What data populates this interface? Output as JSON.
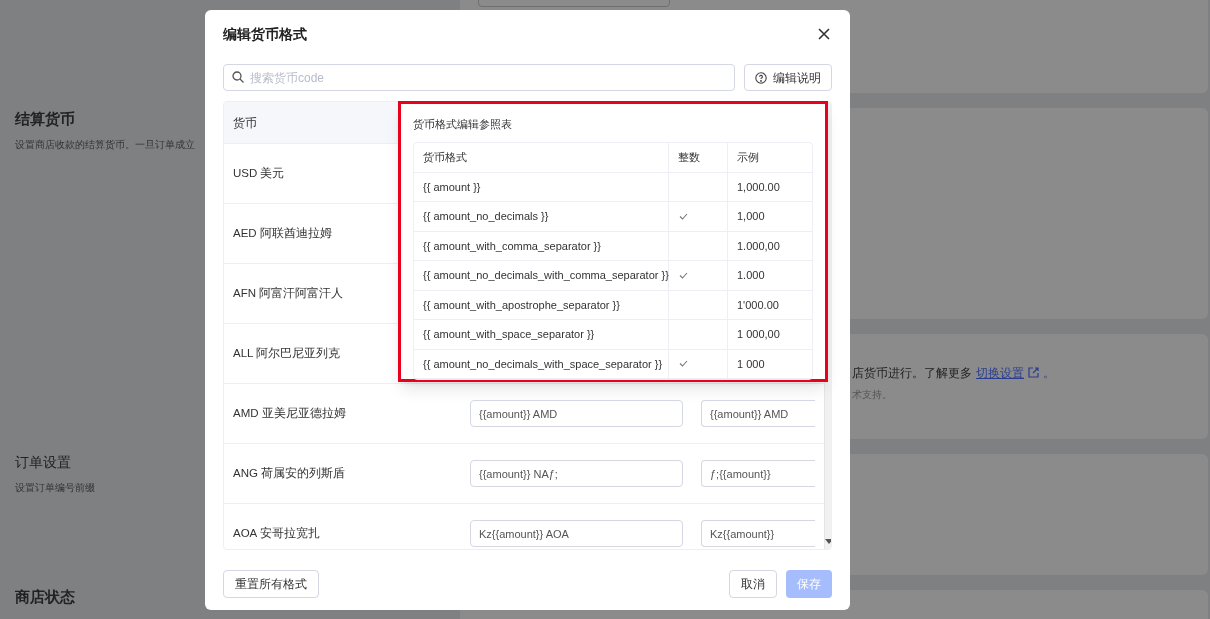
{
  "background": {
    "sections": [
      {
        "title": "结算货币",
        "description": "设置商店收款的结算货币。一旦订单成立"
      },
      {
        "title": "订单设置",
        "description": "设置订单编号前缀"
      },
      {
        "title": "商店状态"
      }
    ],
    "notice": {
      "text": "店货币进行。了解更多",
      "link": "切换设置",
      "suffix": "。",
      "note": "术支持。"
    }
  },
  "dialog": {
    "title": "编辑货币格式",
    "search": {
      "placeholder": "搜索货币code"
    },
    "help_button": "编辑说明",
    "table": {
      "columns": [
        "货币"
      ],
      "rows": [
        {
          "currency": "USD 美元"
        },
        {
          "currency": "AED 阿联酋迪拉姆"
        },
        {
          "currency": "AFN 阿富汗阿富汗人"
        },
        {
          "currency": "ALL 阿尔巴尼亚列克"
        },
        {
          "currency": "AMD 亚美尼亚德拉姆",
          "format_1": "{{amount}} AMD",
          "format_2": "{{amount}} AMD"
        },
        {
          "currency": "ANG 荷属安的列斯盾",
          "format_1": "{{amount}} NAƒ;",
          "format_2": "ƒ;{{amount}}"
        },
        {
          "currency": "AOA 安哥拉宽扎",
          "format_1": "Kz{{amount}} AOA",
          "format_2": "Kz{{amount}}"
        }
      ]
    },
    "reference": {
      "title": "货币格式编辑参照表",
      "columns": [
        "货币格式",
        "整数",
        "示例"
      ],
      "rows": [
        {
          "format": "{{ amount }}",
          "integer": false,
          "example": "1,000.00"
        },
        {
          "format": "{{ amount_no_decimals }}",
          "integer": true,
          "example": "1,000"
        },
        {
          "format": "{{ amount_with_comma_separator }}",
          "integer": false,
          "example": "1.000,00"
        },
        {
          "format": "{{ amount_no_decimals_with_comma_separator }}",
          "integer": true,
          "example": "1.000"
        },
        {
          "format": "{{ amount_with_apostrophe_separator }}",
          "integer": false,
          "example": "1'000.00"
        },
        {
          "format": "{{ amount_with_space_separator }}",
          "integer": false,
          "example": "1 000,00"
        },
        {
          "format": "{{ amount_no_decimals_with_space_separator }}",
          "integer": true,
          "example": "1 000"
        }
      ]
    },
    "buttons": {
      "reset": "重置所有格式",
      "cancel": "取消",
      "save": {
        "label": "保存",
        "disabled": true
      }
    }
  }
}
